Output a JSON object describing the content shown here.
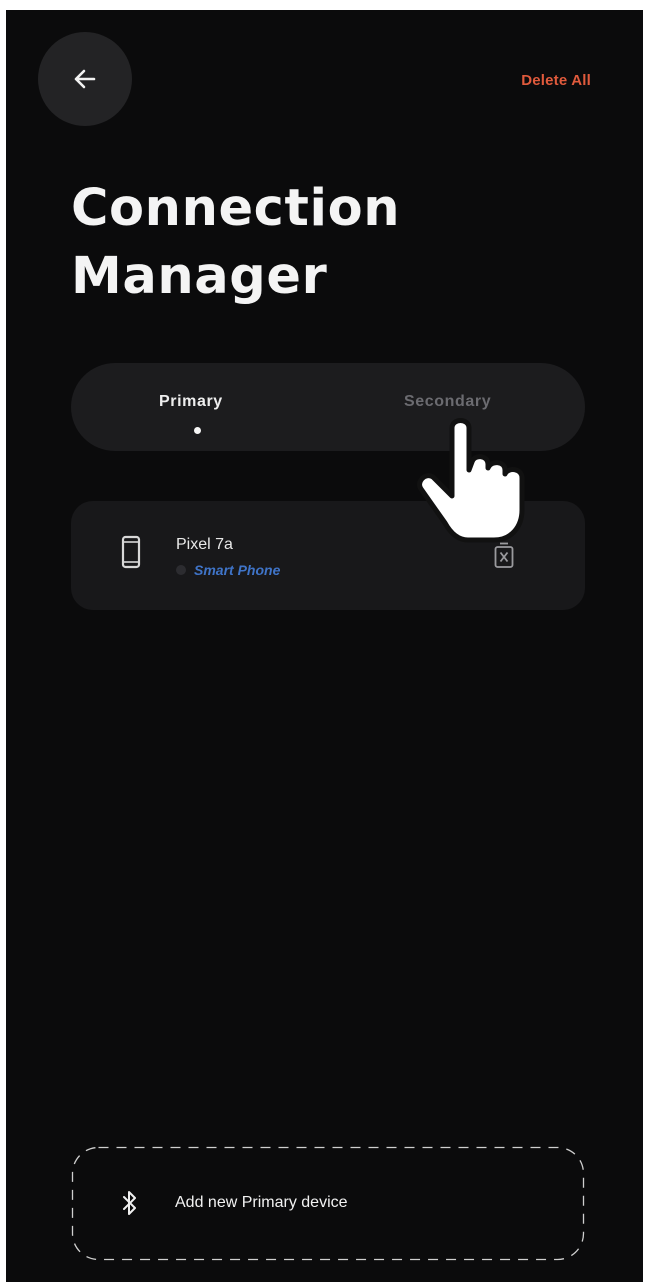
{
  "header": {
    "back_icon": "arrow-left-icon",
    "delete_all_label": "Delete All",
    "accent_color": "#e05a3c"
  },
  "title": {
    "line1": "Connection",
    "line2": "Manager"
  },
  "tabs": [
    {
      "label": "Primary",
      "selected": true
    },
    {
      "label": "Secondary",
      "selected": false
    }
  ],
  "devices": [
    {
      "name": "Pixel 7a",
      "type": "Smart Phone",
      "icon": "smartphone-icon",
      "action_icon": "delete-device-icon",
      "type_color": "#3f74c8"
    }
  ],
  "add_device": {
    "label": "Add new Primary device",
    "icon": "bluetooth-icon"
  },
  "overlay": {
    "icon": "pointing-hand-cursor-icon"
  }
}
